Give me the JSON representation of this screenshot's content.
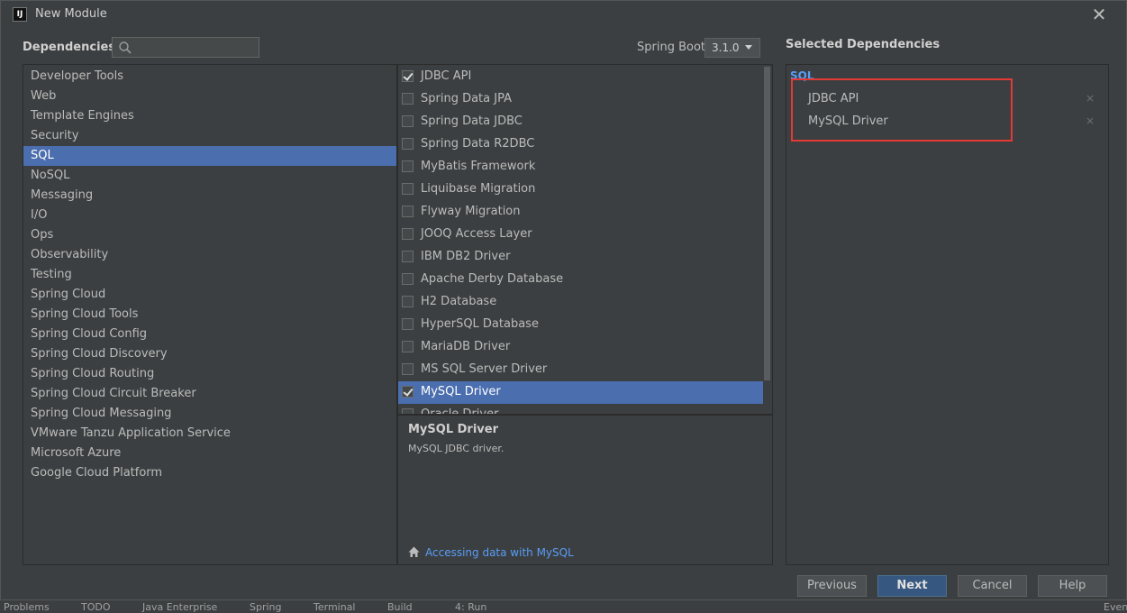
{
  "window": {
    "title": "New Module",
    "app_icon": "IJ"
  },
  "header": {
    "dependencies_label": "Dependencies",
    "search_placeholder": "",
    "spring_boot_label": "Spring Boot",
    "spring_boot_version": "3.1.0",
    "selected_label": "Selected Dependencies"
  },
  "categories": [
    {
      "label": "Developer Tools"
    },
    {
      "label": "Web"
    },
    {
      "label": "Template Engines"
    },
    {
      "label": "Security"
    },
    {
      "label": "SQL",
      "selected": true
    },
    {
      "label": "NoSQL"
    },
    {
      "label": "Messaging"
    },
    {
      "label": "I/O"
    },
    {
      "label": "Ops"
    },
    {
      "label": "Observability"
    },
    {
      "label": "Testing"
    },
    {
      "label": "Spring Cloud"
    },
    {
      "label": "Spring Cloud Tools"
    },
    {
      "label": "Spring Cloud Config"
    },
    {
      "label": "Spring Cloud Discovery"
    },
    {
      "label": "Spring Cloud Routing"
    },
    {
      "label": "Spring Cloud Circuit Breaker"
    },
    {
      "label": "Spring Cloud Messaging"
    },
    {
      "label": "VMware Tanzu Application Service"
    },
    {
      "label": "Microsoft Azure"
    },
    {
      "label": "Google Cloud Platform"
    }
  ],
  "dependencies": [
    {
      "label": "JDBC API",
      "checked": true
    },
    {
      "label": "Spring Data JPA",
      "checked": false
    },
    {
      "label": "Spring Data JDBC",
      "checked": false
    },
    {
      "label": "Spring Data R2DBC",
      "checked": false
    },
    {
      "label": "MyBatis Framework",
      "checked": false
    },
    {
      "label": "Liquibase Migration",
      "checked": false
    },
    {
      "label": "Flyway Migration",
      "checked": false
    },
    {
      "label": "JOOQ Access Layer",
      "checked": false
    },
    {
      "label": "IBM DB2 Driver",
      "checked": false
    },
    {
      "label": "Apache Derby Database",
      "checked": false
    },
    {
      "label": "H2 Database",
      "checked": false
    },
    {
      "label": "HyperSQL Database",
      "checked": false
    },
    {
      "label": "MariaDB Driver",
      "checked": false
    },
    {
      "label": "MS SQL Server Driver",
      "checked": false
    },
    {
      "label": "MySQL Driver",
      "checked": true,
      "selected": true
    },
    {
      "label": "Oracle Driver",
      "checked": false
    }
  ],
  "description": {
    "title": "MySQL Driver",
    "text": "MySQL JDBC driver.",
    "guide_icon": "home-icon",
    "guide_link": "Accessing data with MySQL"
  },
  "selected": {
    "group": "SQL",
    "items": [
      {
        "label": "JDBC API",
        "remove": "×"
      },
      {
        "label": "MySQL Driver",
        "remove": "×"
      }
    ]
  },
  "buttons": {
    "previous": "Previous",
    "next": "Next",
    "cancel": "Cancel",
    "help": "Help"
  },
  "ide_toolbar": [
    "Problems",
    "TODO",
    "Java Enterprise",
    "Spring",
    "Terminal",
    "Build",
    "4: Run",
    "Event"
  ],
  "colors": {
    "selection": "#4b6eaf",
    "link": "#589df6",
    "highlight_box": "#e53935",
    "primary_button": "#365880"
  }
}
